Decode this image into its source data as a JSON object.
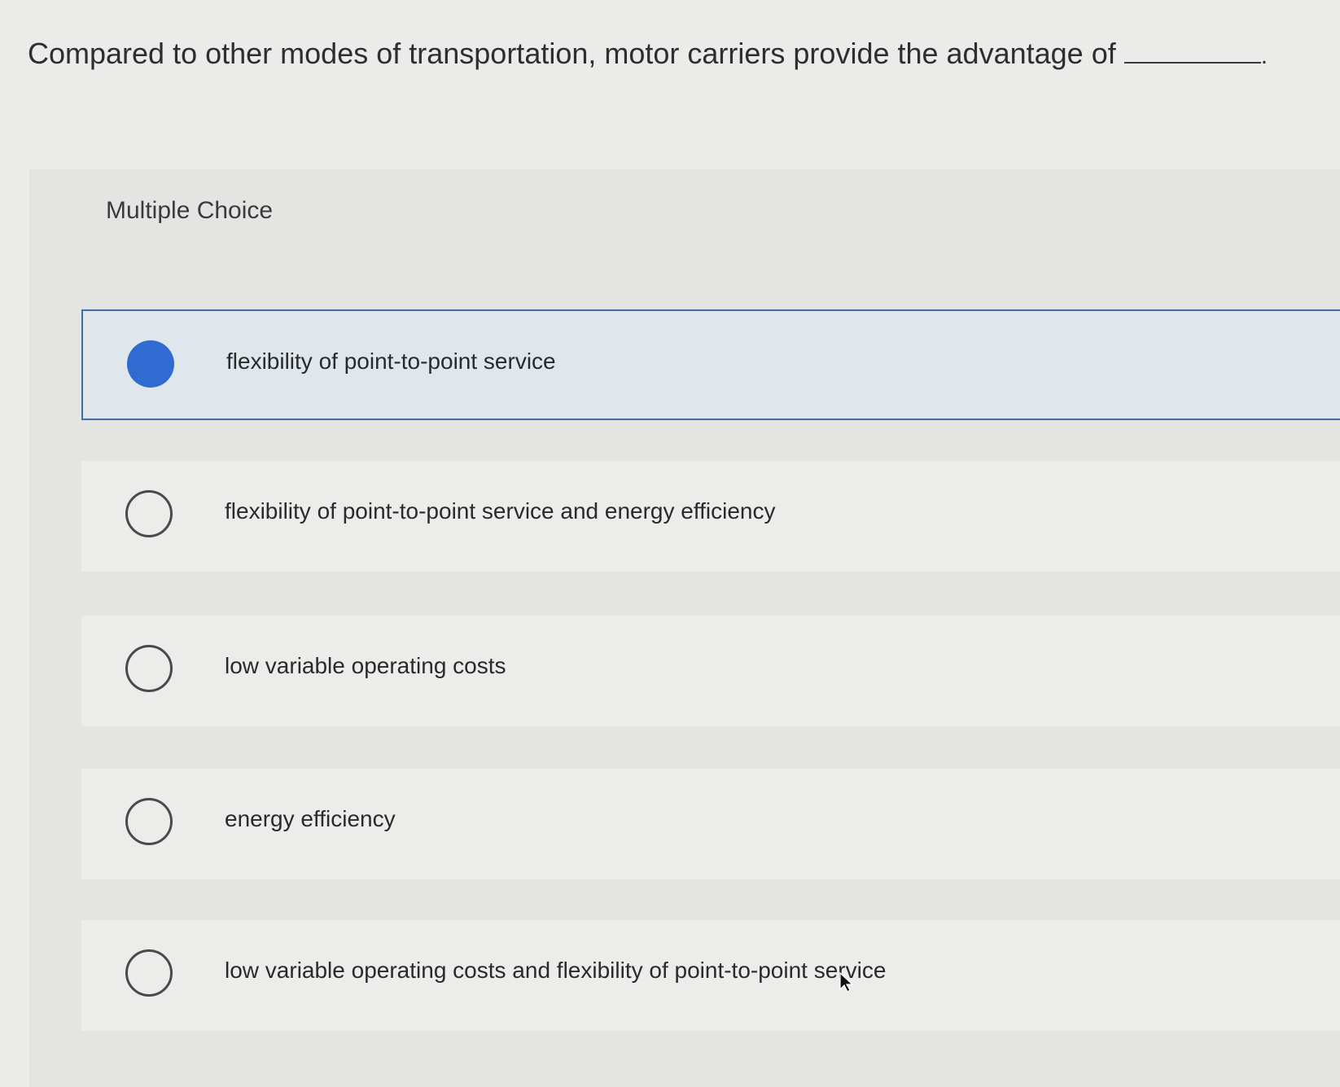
{
  "question": {
    "text": "Compared to other modes of transportation, motor carriers provide the advantage of",
    "period": "."
  },
  "multiple_choice": {
    "label": "Multiple Choice",
    "options": [
      {
        "label": "flexibility of point-to-point service",
        "selected": true
      },
      {
        "label": "flexibility of point-to-point service and energy efficiency",
        "selected": false
      },
      {
        "label": "low variable operating costs",
        "selected": false
      },
      {
        "label": "energy efficiency",
        "selected": false
      },
      {
        "label": "low variable operating costs and flexibility of point-to-point service",
        "selected": false
      }
    ]
  },
  "colors": {
    "selected_radio": "#2f6bd0",
    "selected_border": "#3e6fa3",
    "selected_background": "#e0e7ec"
  },
  "icons": {
    "cursor": "mouse-pointer-icon"
  }
}
